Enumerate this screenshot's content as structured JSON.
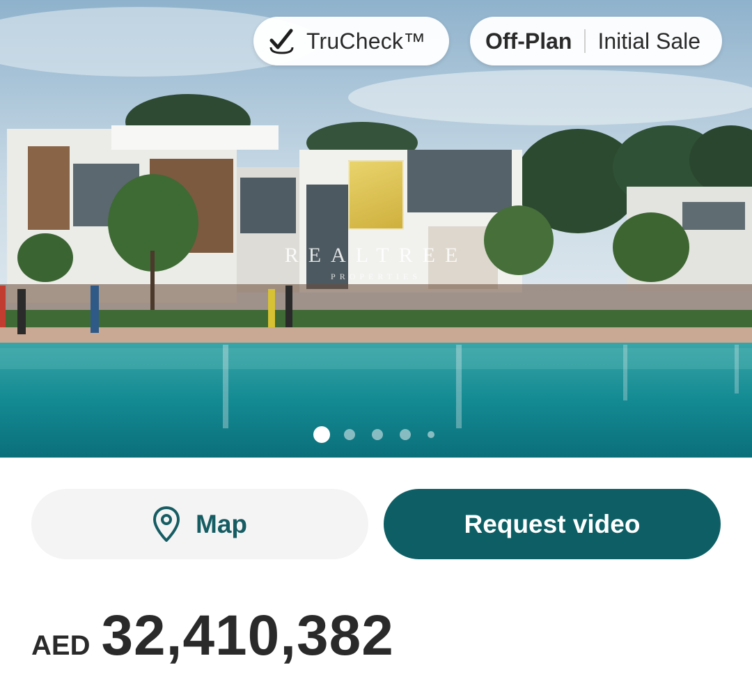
{
  "badges": {
    "trucheck": "TruCheck™",
    "completion_status": "Off-Plan",
    "sale_type": "Initial Sale"
  },
  "watermark": {
    "brand": "REALTREE",
    "subtitle": "PROPERTIES"
  },
  "gallery": {
    "total_images": 5,
    "active_index": 0
  },
  "actions": {
    "map_label": "Map",
    "request_video_label": "Request video"
  },
  "price": {
    "currency": "AED",
    "amount": "32,410,382"
  },
  "colors": {
    "primary": "#0d5f65",
    "map_text": "#155c63",
    "map_bg": "#f4f4f4"
  },
  "icons": {
    "trucheck": "check-icon",
    "map": "location-pin-icon"
  }
}
